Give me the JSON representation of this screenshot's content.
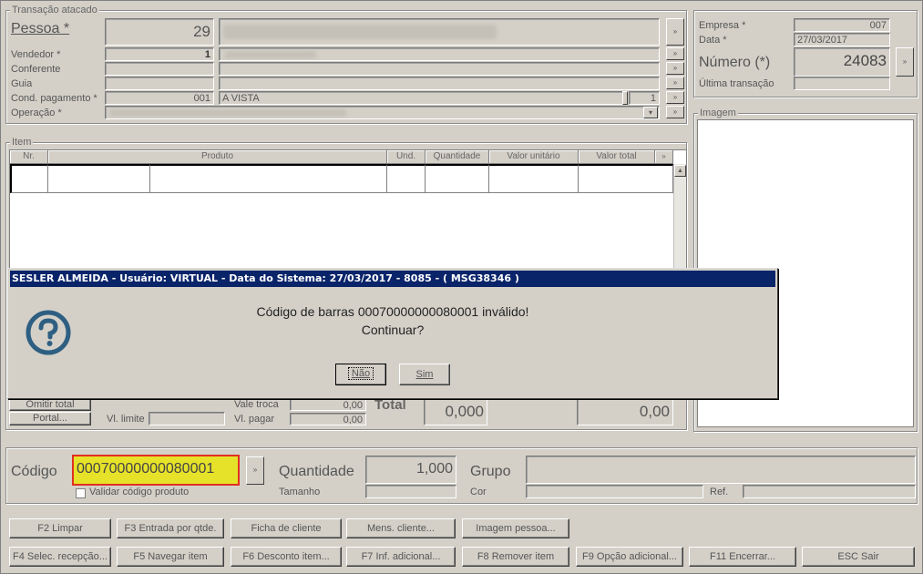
{
  "transacao": {
    "title": "Transação atacado",
    "pessoa_label": "Pessoa *",
    "pessoa_code": "29",
    "vendedor_label": "Vendedor *",
    "vendedor_code": "1",
    "conferente_label": "Conferente",
    "guia_label": "Guia",
    "cond_label": "Cond. pagamento *",
    "cond_code": "001",
    "cond_value": "A VISTA",
    "cond_parcelas": "1",
    "operacao_label": "Operação *"
  },
  "empresa": {
    "empresa_label": "Empresa *",
    "empresa_value": "007",
    "data_label": "Data *",
    "data_value": "27/03/2017",
    "numero_label": "Número (*)",
    "numero_value": "24083",
    "ultima_label": "Última transação"
  },
  "imagem": {
    "title": "Imagem"
  },
  "item": {
    "title": "Item",
    "columns": [
      "Nr.",
      "Produto",
      "Und.",
      "Quantidade",
      "Valor unitário",
      "Valor total"
    ]
  },
  "totals": {
    "omitir_total": "Omitir total",
    "portal": "Portal...",
    "vl_limite_label": "Vl. limite",
    "vale_troca_label": "Vale troca",
    "vale_troca_value": "0,00",
    "vl_pagar_label": "Vl. pagar",
    "vl_pagar_value": "0,00",
    "total_label": "Total",
    "total_qty": "0,000",
    "total_value": "0,00"
  },
  "entry": {
    "codigo_label": "Código",
    "codigo_value": "00070000000080001",
    "validar_label": "Validar código produto",
    "quantidade_label": "Quantidade",
    "quantidade_value": "1,000",
    "grupo_label": "Grupo",
    "tamanho_label": "Tamanho",
    "cor_label": "Cor",
    "ref_label": "Ref."
  },
  "buttons_row1": [
    "F2 Limpar",
    "F3 Entrada por qtde.",
    "Ficha de cliente",
    "Mens. cliente...",
    "Imagem pessoa..."
  ],
  "buttons_row2": [
    "F4 Selec. recepção...",
    "F5 Navegar item",
    "F6 Desconto item...",
    "F7 Inf. adicional...",
    "F8 Remover item",
    "F9 Opção adicional...",
    "F11 Encerrar...",
    "ESC Sair"
  ],
  "dialog": {
    "title": "SESLER ALMEIDA - Usuário: VIRTUAL - Data do Sistema: 27/03/2017 - 8085 - ( MSG38346 )",
    "message_line1": "Código de barras 00070000000080001 inválido!",
    "message_line2": "Continuar?",
    "no_label": "Não",
    "yes_label": "Sim",
    "icon": "question-icon"
  },
  "colors": {
    "window_bg": "#d4d0c8",
    "titlebar": "#0a246a",
    "highlight_field": "#e6e22a",
    "highlight_border": "#e03020",
    "icon_blue": "#2e5f82"
  }
}
